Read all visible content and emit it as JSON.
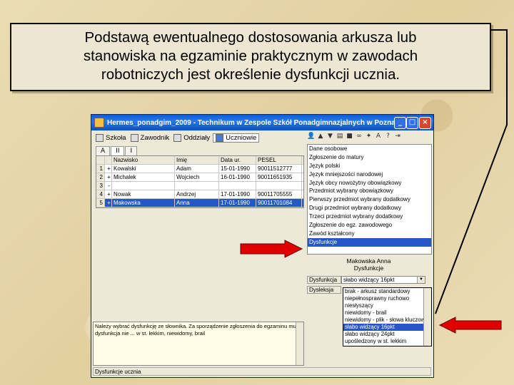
{
  "callout": {
    "line1": "Podstawą ewentualnego dostosowania arkusza lub",
    "line2": "stanowiska na egzaminie praktycznym w zawodach",
    "line3": "robotniczych jest określenie dysfunkcji ucznia."
  },
  "window": {
    "title": "Hermes_ponadgim_2009 - Technikum w Zespole Szkół Ponadgimnazjalnych w Pozna...",
    "minimize": "_",
    "maximize": "□",
    "close": "×"
  },
  "toolbar": {
    "szkola": "Szkoła",
    "zawodnik": "Zawodnik",
    "oddzialy": "Oddziały",
    "uczniowie": "Uczniowie"
  },
  "tabs": [
    "A",
    "II",
    "I"
  ],
  "grid": {
    "headers": [
      "Nazwisko",
      "Imię",
      "Data ur.",
      "PESEL"
    ],
    "rows": [
      {
        "n": "1",
        "c1": "Kowalski",
        "c2": "Adam",
        "c3": "15-01-1990",
        "c4": "90011512777"
      },
      {
        "n": "2",
        "c1": "Michalek",
        "c2": "Wojciech",
        "c3": "16-01-1990",
        "c4": "90011651935"
      },
      {
        "n": "3",
        "c1": "",
        "c2": "",
        "c3": "",
        "c4": ""
      },
      {
        "n": "4",
        "c1": "Nowak",
        "c2": "Andrzej",
        "c3": "17-01-1990",
        "c4": "90011705555"
      },
      {
        "n": "5",
        "c1": "Makowska",
        "c2": "Anna",
        "c3": "17-01-1990",
        "c4": "90011701084"
      }
    ]
  },
  "list": [
    "Dane osobowe",
    "Zgłoszenie do matury",
    "Język polski",
    "Język mniejszości narodowej",
    "Język obcy nowożytny obowiązkowy",
    "Przedmiot wybrany obowiązkowy",
    "Pierwszy przedmiot wybrany dodatkowy",
    "Drugi przedmiot wybrany dodatkowy",
    "Trzeci przedmiot wybrany dodatkowy",
    "Zgłoszenie do egz. zawodowego",
    "Zawód kształcony",
    "Dysfunkcje"
  ],
  "person": {
    "name": "Makowska Anna",
    "section": "Dysfunkcje"
  },
  "fields": {
    "f1_label": "Dysfunkcja",
    "f1_value": "słabo widzący 16pkt",
    "f2_label": "Dysleksja"
  },
  "dropdown": [
    "brak - arkusz standardowy",
    "niepełnosprawny ruchowo",
    "niesłyszący",
    "niewidomy - brail",
    "niewidomy - plik - słowa kluczowe",
    "słabo widzący 16pkt",
    "słabo widzący 24pkt",
    "upośledzony w st. lekkim"
  ],
  "memo": {
    "text": "Należy wybrać dysfunkcję ze słownika. Za sporządzenie zgłoszenia do egzaminu musi dysfunkcja nie ... w st. lekkim, niewidomy, brail"
  },
  "status": {
    "text": "Dysfunkcje ucznia"
  },
  "colors": {
    "selection": "#2557c8",
    "arrow": "#e00000",
    "titlebar": "#0a5fd8"
  }
}
